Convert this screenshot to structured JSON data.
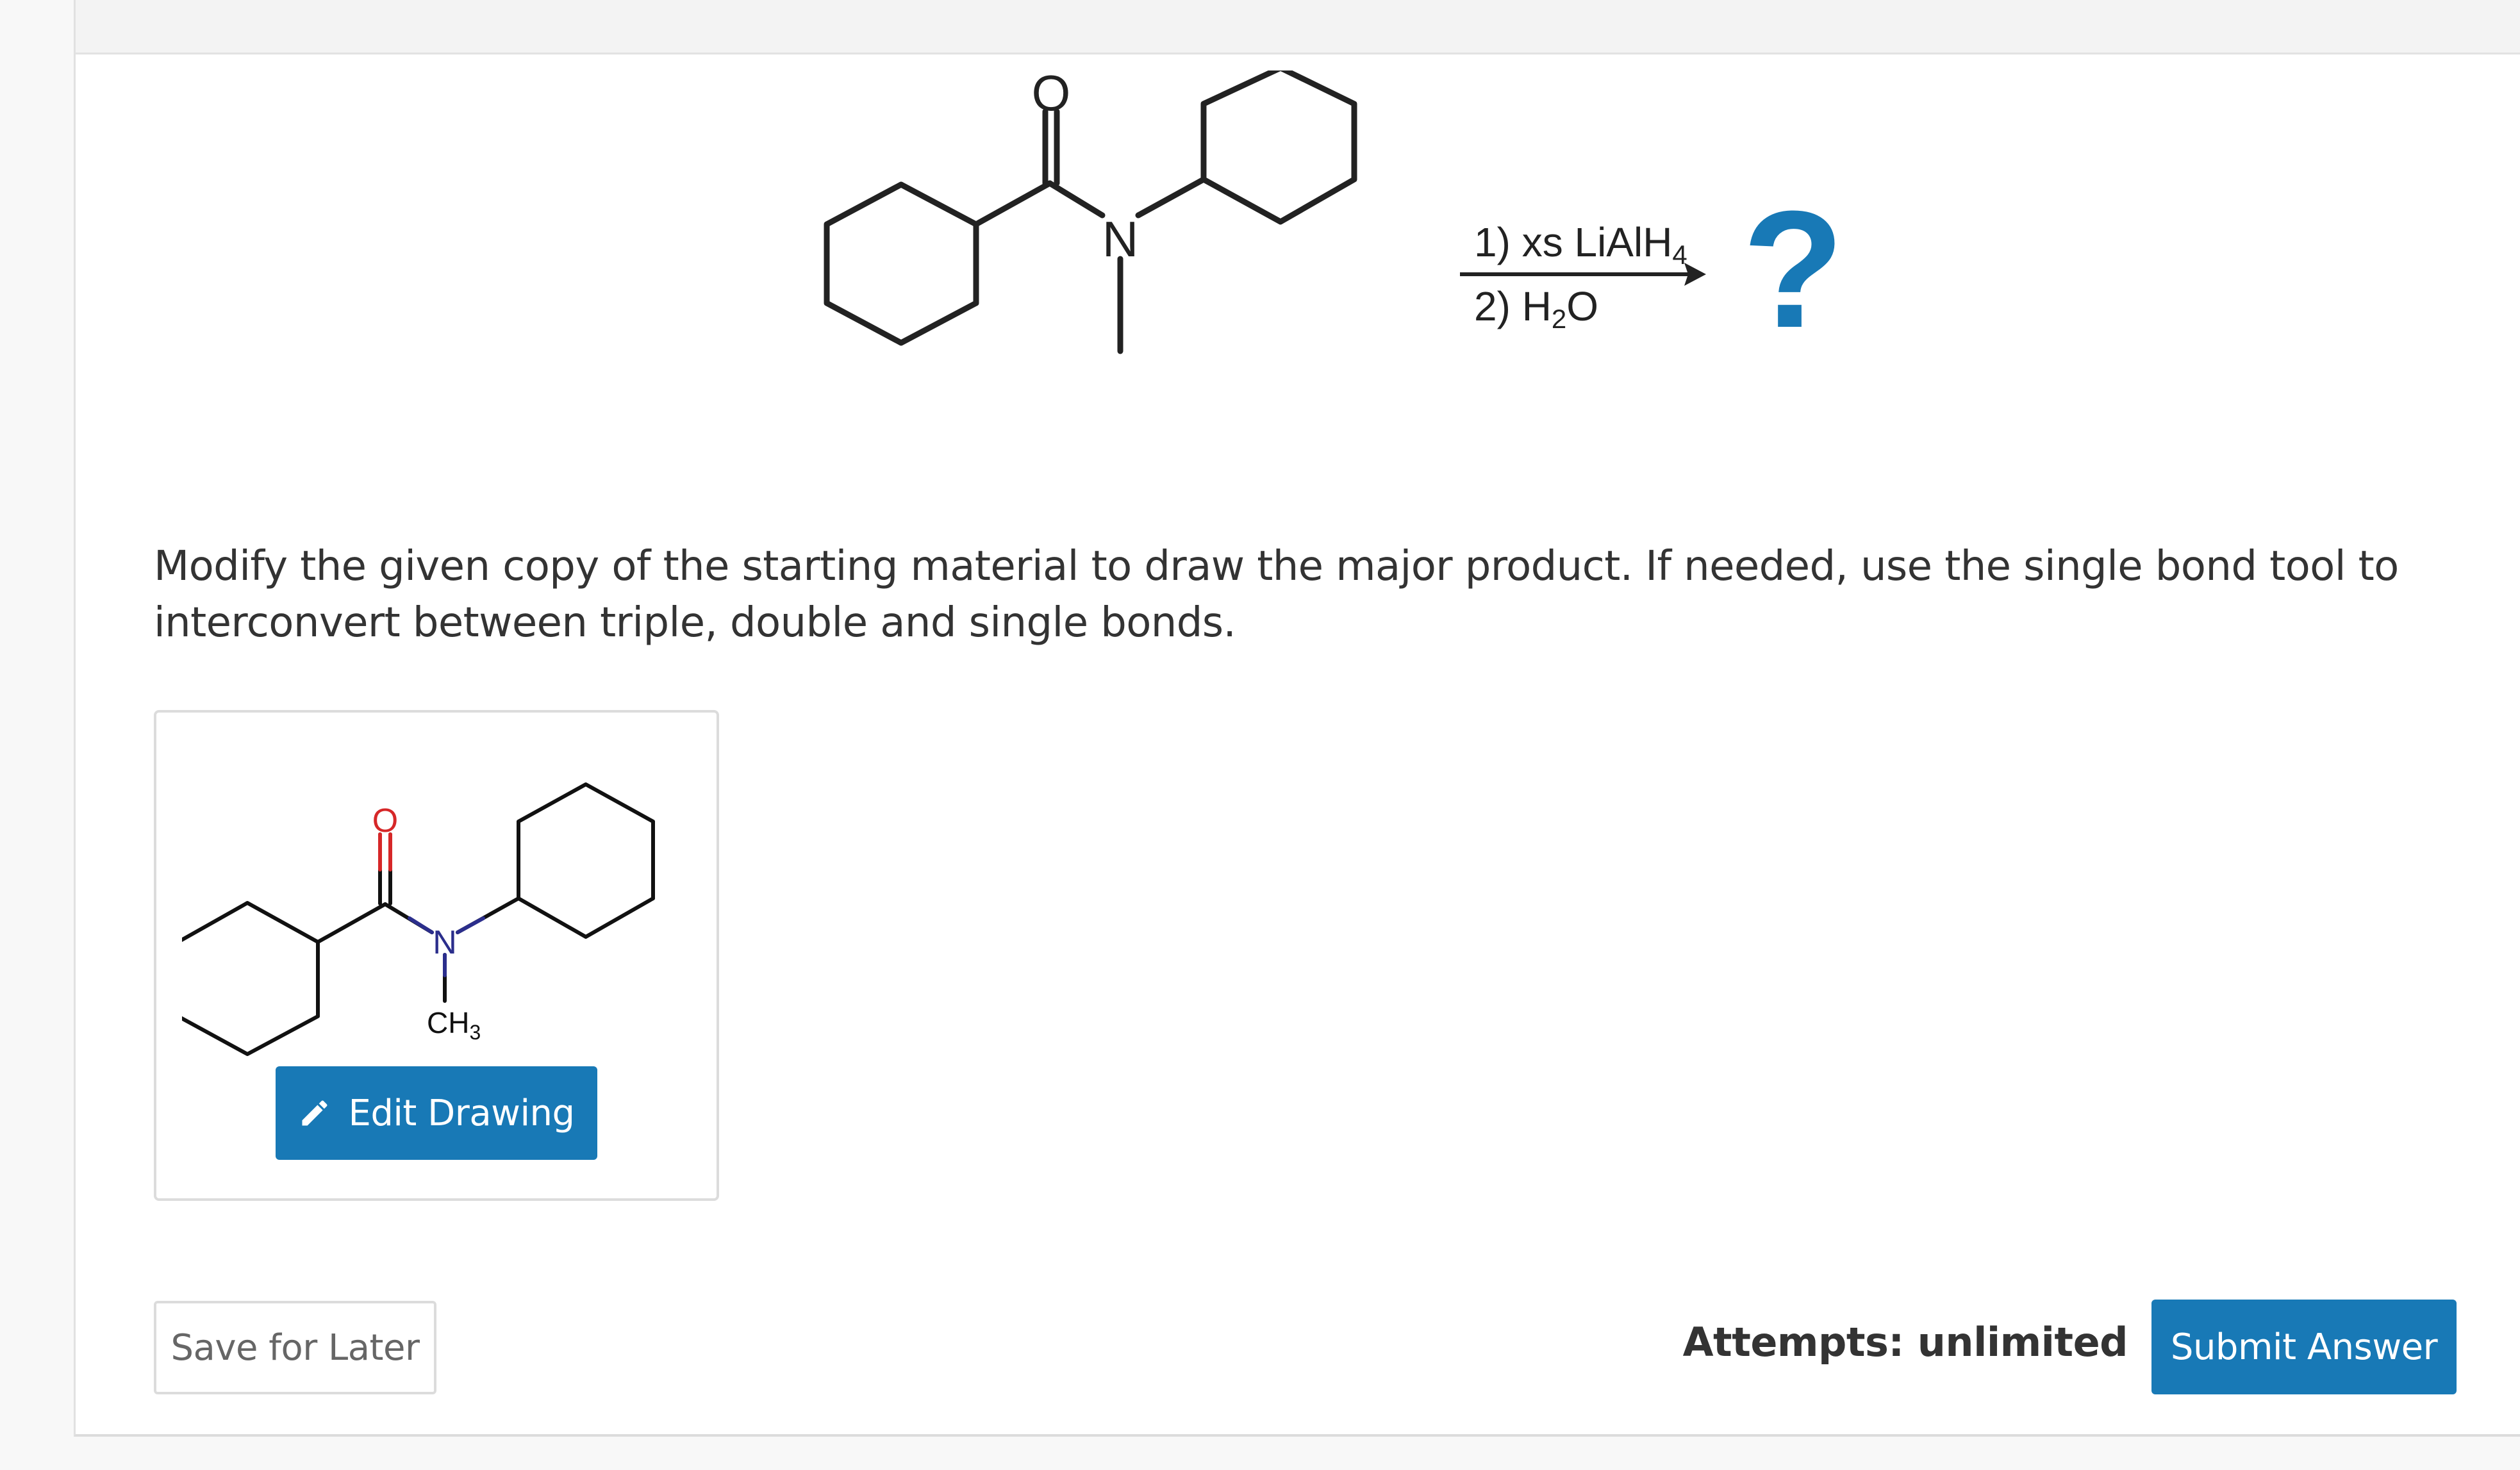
{
  "reaction": {
    "carbonyl_oxygen": "O",
    "amide_nitrogen": "N",
    "reagent_step1": "1) xs LiAlH4",
    "reagent_step2": "2) H2O",
    "product_placeholder": "?"
  },
  "question": {
    "text": "Modify the given copy of the starting material to draw the major product. If needed, use the single bond tool to interconvert between triple, double and single bonds."
  },
  "drawing": {
    "oxygen_label": "O",
    "nitrogen_label": "N",
    "methyl_label": "CH3",
    "edit_button_label": "Edit Drawing"
  },
  "footer": {
    "save_label": "Save for Later",
    "attempts_label": "Attempts: unlimited",
    "submit_label": "Submit Answer"
  },
  "colors": {
    "primary_button": "#1879b6",
    "question_mark": "#1879b6",
    "oxygen_red": "#d62728",
    "nitrogen_blue": "#2b2e8c"
  }
}
